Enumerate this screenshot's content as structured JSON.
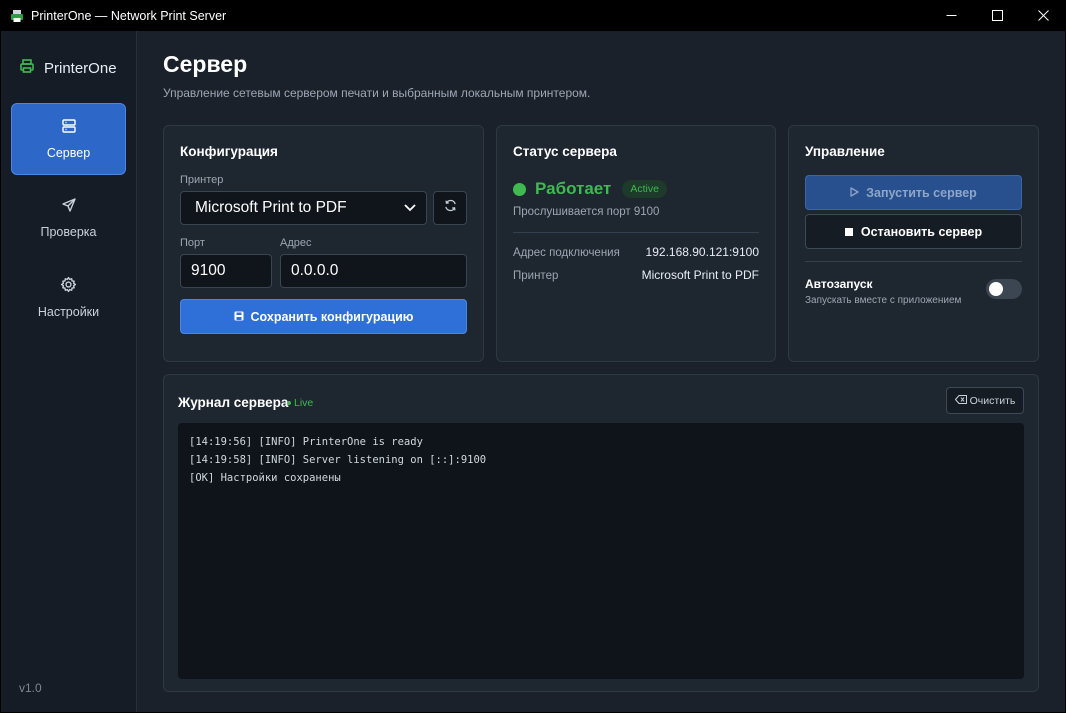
{
  "window": {
    "title": "PrinterOne — Network Print Server"
  },
  "sidebar": {
    "brand": "PrinterOne",
    "items": [
      {
        "label": "Сервер",
        "icon": "server-icon",
        "active": true
      },
      {
        "label": "Проверка",
        "icon": "send-icon",
        "active": false
      },
      {
        "label": "Настройки",
        "icon": "gear-icon",
        "active": false
      }
    ],
    "version": "v1.0"
  },
  "page": {
    "title": "Сервер",
    "subtitle": "Управление сетевым сервером печати и выбранным локальным принтером."
  },
  "config": {
    "title": "Конфигурация",
    "printer_label": "Принтер",
    "printer_value": "Microsoft Print to PDF",
    "port_label": "Порт",
    "port_value": "9100",
    "address_label": "Адрес",
    "address_value": "0.0.0.0",
    "save_label": "Сохранить конфигурацию"
  },
  "status": {
    "title": "Статус сервера",
    "state": "Работает",
    "badge": "Active",
    "listening": "Прослушивается порт 9100",
    "address_label": "Адрес подключения",
    "address_value": "192.168.90.121:9100",
    "printer_label": "Принтер",
    "printer_value": "Microsoft Print to PDF"
  },
  "control": {
    "title": "Управление",
    "start_label": "Запустить сервер",
    "stop_label": "Остановить сервер",
    "autostart_title": "Автозапуск",
    "autostart_desc": "Запускать вместе с приложением",
    "autostart_on": false
  },
  "log": {
    "title": "Журнал сервера",
    "live": "Live",
    "clear_label": "Очистить",
    "lines": [
      "[14:19:56] [INFO] PrinterOne is ready",
      "[14:19:58] [INFO] Server listening on [::]:9100",
      "[OK] Настройки сохранены"
    ]
  },
  "colors": {
    "accent": "#2f6fd8",
    "success": "#3fb950",
    "background": "#1a212b",
    "card": "#1e2630"
  }
}
